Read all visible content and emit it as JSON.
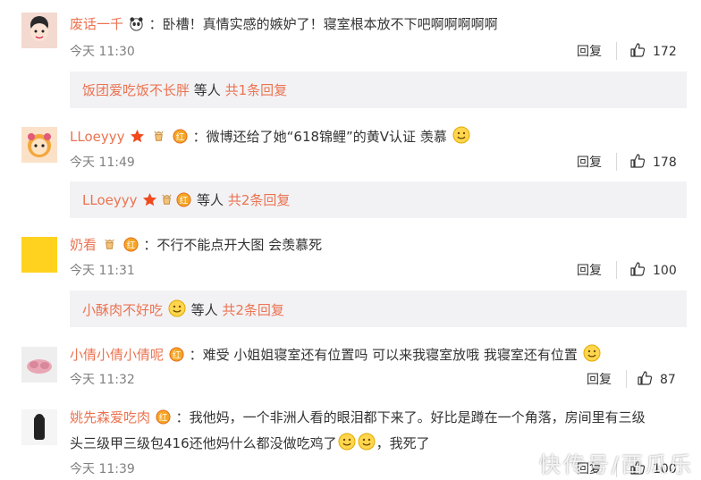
{
  "colors": {
    "name": "#eb7350",
    "text": "#333333",
    "time": "#808080",
    "subbg": "#f2f2f5"
  },
  "comments": [
    {
      "user": "废话一千",
      "text": "：卧槽！真情实感的嫉妒了！寝室根本放不下吧啊啊啊啊啊",
      "time": "今天 11:30",
      "reply_label": "回复",
      "likes": "172",
      "sub": {
        "name": "饭团爱吃饭不长胖",
        "mid": " 等人 ",
        "count": "共1条回复"
      }
    },
    {
      "user": "LLoeyyy",
      "text": "：微博还给了她“618锦鲤”的黄V认证 羡慕",
      "time": "今天 11:49",
      "reply_label": "回复",
      "likes": "178",
      "sub": {
        "name": "LLoeyyy",
        "mid": " 等人 ",
        "count": "共2条回复"
      }
    },
    {
      "user": "奶看",
      "text": "：不行不能点开大图 会羡慕死",
      "time": "今天 11:31",
      "reply_label": "回复",
      "likes": "100",
      "sub": {
        "name": "小酥肉不好吃",
        "mid": " 等人 ",
        "count": "共2条回复"
      }
    },
    {
      "user": "小倩小倩小倩呢",
      "text": "：难受 小姐姐寝室还有位置吗 可以来我寝室放哦 我寝室还有位置",
      "time": "今天 11:32",
      "reply_label": "回复",
      "likes": "87"
    },
    {
      "user": "姚先森爱吃肉",
      "text": "：我他妈，一个非洲人看的眼泪都下来了。好比是蹲在一个角落，房间里有三级",
      "text2": "头三级甲三级包416还他妈什么都没做吃鸡了",
      "text2b": "，我死了",
      "time": "今天 11:39",
      "reply_label": "回复",
      "likes": "100"
    }
  ],
  "watermark": "快传号/西瓜乐"
}
